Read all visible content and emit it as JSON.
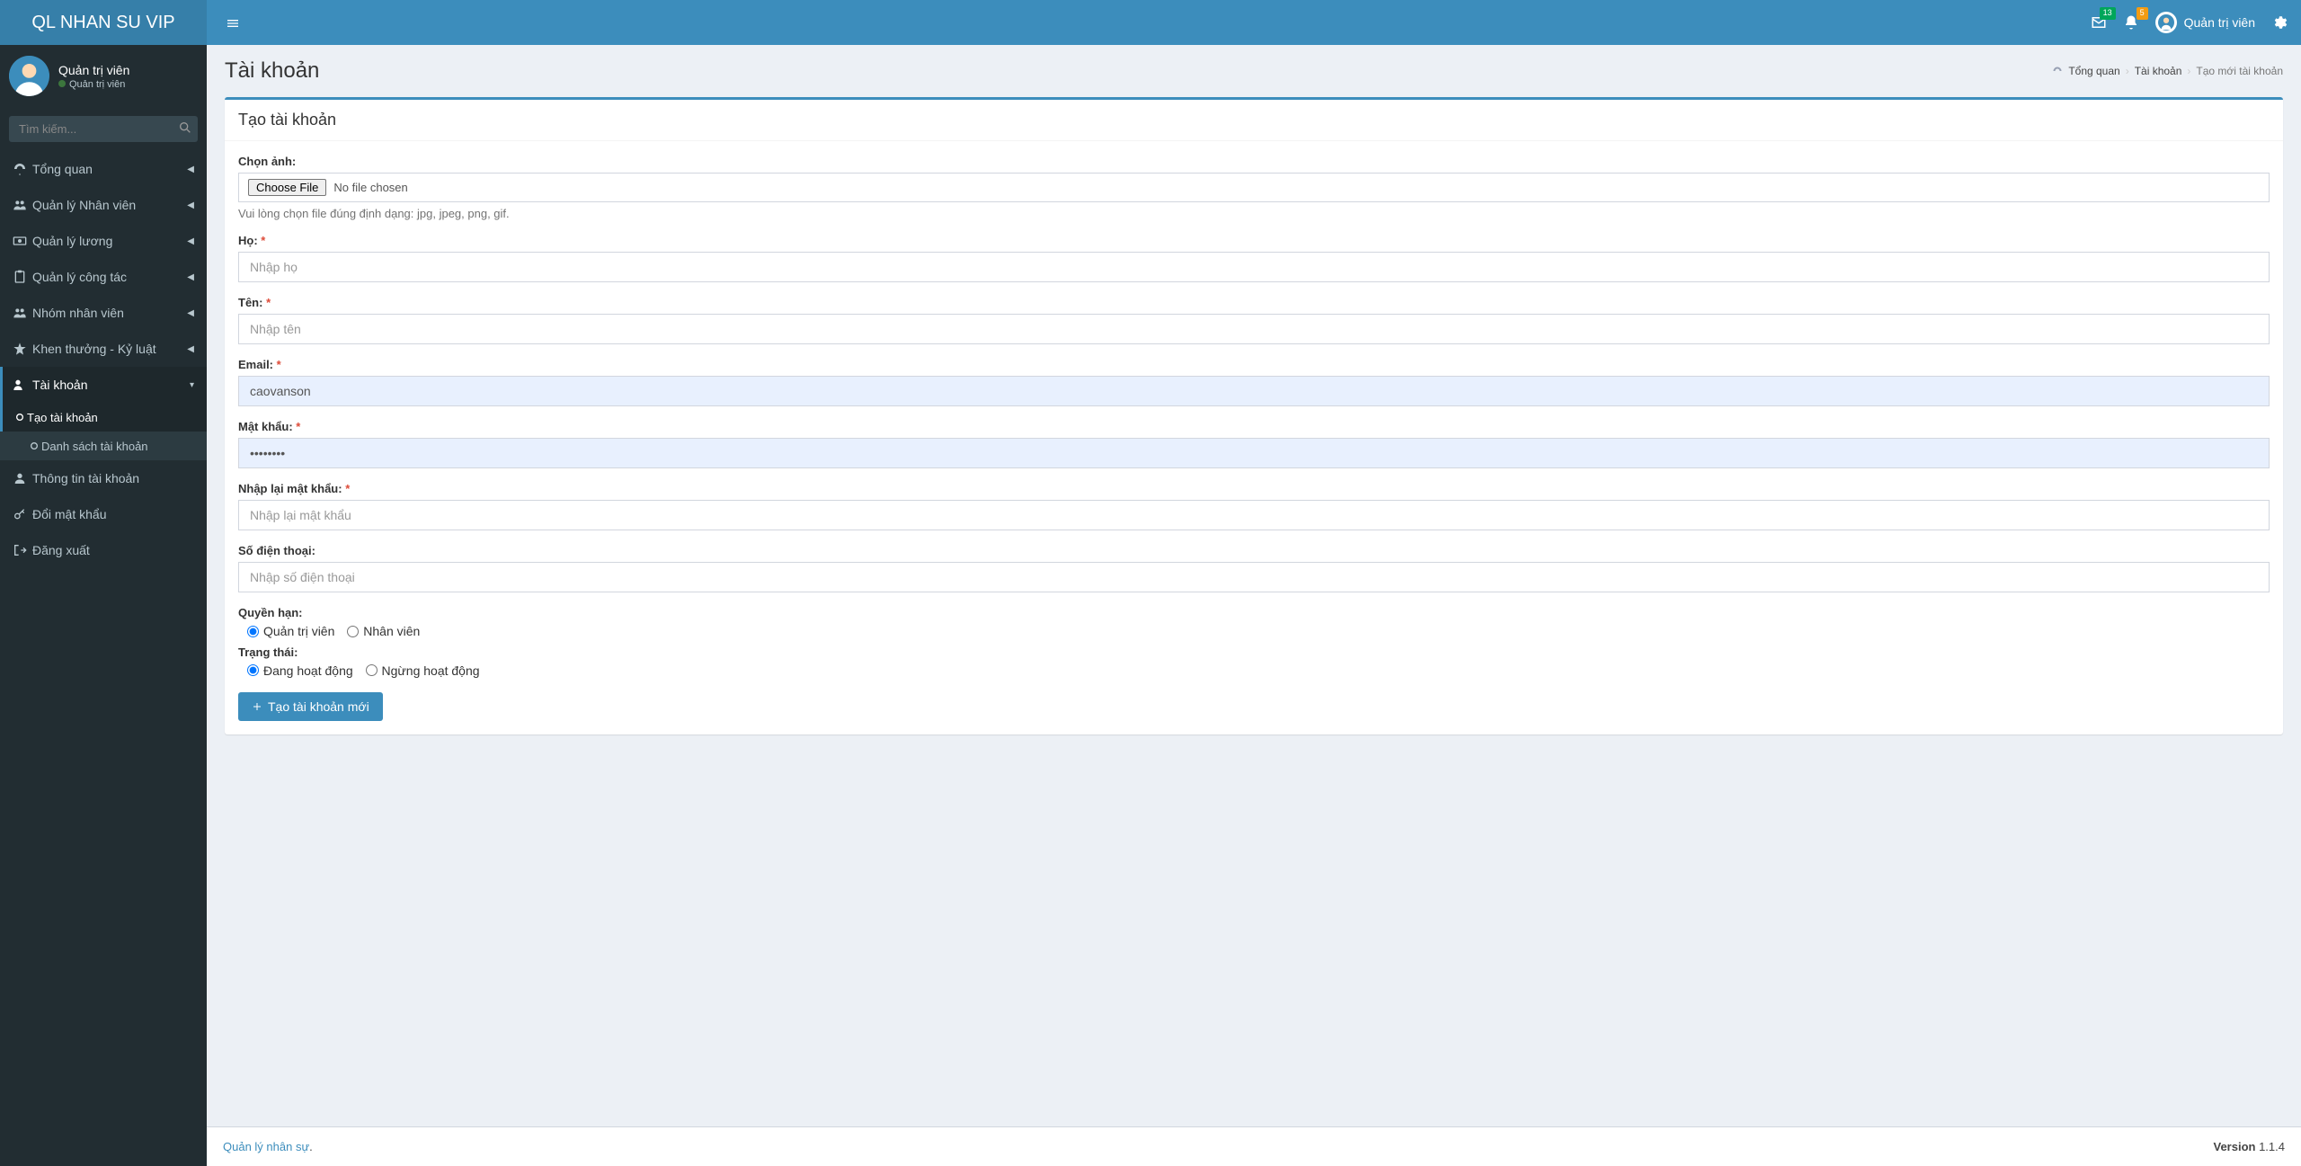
{
  "brand": "QL NHAN SU VIP",
  "header": {
    "mail_badge": "13",
    "bell_badge": "5",
    "user_name": "Quản trị viên"
  },
  "sidebar": {
    "user_name": "Quản trị viên",
    "user_role": "Quản trị viên",
    "search_placeholder": "Tìm kiếm...",
    "items": [
      {
        "label": "Tổng quan"
      },
      {
        "label": "Quản lý Nhân viên"
      },
      {
        "label": "Quản lý lương"
      },
      {
        "label": "Quản lý công tác"
      },
      {
        "label": "Nhóm nhân viên"
      },
      {
        "label": "Khen thưởng - Kỷ luật"
      },
      {
        "label": "Tài khoản"
      },
      {
        "label": "Thông tin tài khoản"
      },
      {
        "label": "Đổi mật khẩu"
      },
      {
        "label": "Đăng xuất"
      }
    ],
    "account_submenu": [
      {
        "label": "Tạo tài khoản"
      },
      {
        "label": "Danh sách tài khoản"
      }
    ]
  },
  "page": {
    "title": "Tài khoản",
    "breadcrumb": {
      "home": "Tổng quan",
      "mid": "Tài khoản",
      "last": "Tạo mới tài khoản"
    },
    "box_title": "Tạo tài khoản",
    "form": {
      "image_label": "Chọn ảnh:",
      "choose_file_btn": "Choose File",
      "no_file_text": "No file chosen",
      "image_help": "Vui lòng chọn file đúng định dạng: jpg, jpeg, png, gif.",
      "lastname_label": "Họ:",
      "lastname_placeholder": "Nhập họ",
      "firstname_label": "Tên:",
      "firstname_placeholder": "Nhập tên",
      "email_label": "Email:",
      "email_value": "caovanson",
      "password_label": "Mật khẩu:",
      "password_value": "••••••••",
      "repassword_label": "Nhập lại mật khẩu:",
      "repassword_placeholder": "Nhập lại mật khẩu",
      "phone_label": "Số điện thoại:",
      "phone_placeholder": "Nhập số điện thoại",
      "role_label": "Quyền hạn:",
      "role_admin": "Quản trị viên",
      "role_employee": "Nhân viên",
      "status_label": "Trạng thái:",
      "status_active": "Đang hoạt động",
      "status_inactive": "Ngừng hoạt động",
      "submit_label": "Tạo tài khoản mới"
    }
  },
  "footer": {
    "left": "Quản lý nhân sự",
    "version_label": "Version",
    "version": "1.1.4"
  }
}
